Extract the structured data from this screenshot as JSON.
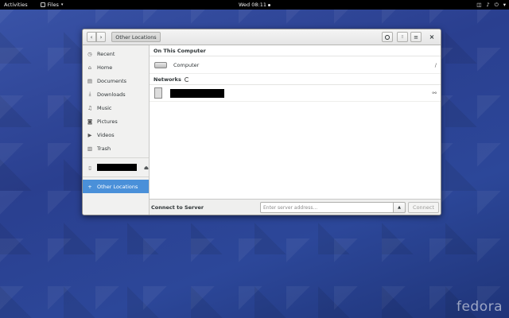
{
  "topbar": {
    "activities": "Activities",
    "app_menu": "Files",
    "app_menu_caret": "▾",
    "clock": "Wed 08:11",
    "network_icon": "◫",
    "volume_icon": "♪",
    "power_icon": "⏻",
    "menu_caret": "▾"
  },
  "header": {
    "back": "‹",
    "forward": "›",
    "location": "Other Locations",
    "search_icon": "🔍",
    "view_icon": "⁝⁝",
    "menu_icon": "≡",
    "close": "×"
  },
  "sidebar": {
    "items": [
      {
        "label": "Recent",
        "icon": "◷"
      },
      {
        "label": "Home",
        "icon": "⌂"
      },
      {
        "label": "Documents",
        "icon": "▤"
      },
      {
        "label": "Downloads",
        "icon": "⤓"
      },
      {
        "label": "Music",
        "icon": "♫"
      },
      {
        "label": "Pictures",
        "icon": "◙"
      },
      {
        "label": "Videos",
        "icon": "▶"
      },
      {
        "label": "Trash",
        "icon": "▥"
      }
    ],
    "device_icon": "▯",
    "eject_icon": "⏏",
    "other_locations": "Other Locations",
    "other_locations_icon": "+"
  },
  "content": {
    "on_this_computer": "On This Computer",
    "computer_label": "Computer",
    "computer_path": "/",
    "networks": "Networks",
    "network_share_icon": "⚯"
  },
  "bottom": {
    "label": "Connect to Server",
    "placeholder": "Enter server address...",
    "dropdown": "▲",
    "connect": "Connect"
  },
  "brand": "fedora"
}
